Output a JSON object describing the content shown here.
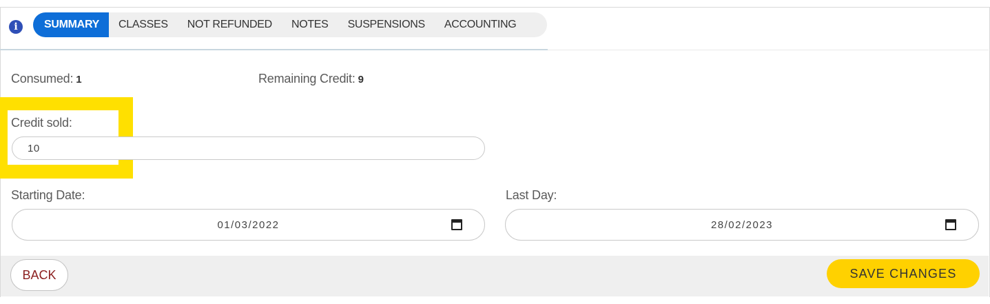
{
  "tabs": [
    {
      "label": "SUMMARY",
      "active": true
    },
    {
      "label": "CLASSES"
    },
    {
      "label": "NOT REFUNDED"
    },
    {
      "label": "NOTES"
    },
    {
      "label": "SUSPENSIONS"
    },
    {
      "label": "ACCOUNTING"
    }
  ],
  "info_icon": {
    "name": "info-icon",
    "glyph": "i"
  },
  "summary": {
    "consumed_label": "Consumed:",
    "consumed_value": "1",
    "remaining_label": "Remaining Credit:",
    "remaining_value": "9"
  },
  "credit_sold": {
    "label": "Credit sold:",
    "value": "10"
  },
  "starting_date": {
    "label": "Starting Date:",
    "value": "01/03/2022",
    "icon": "calendar-icon"
  },
  "last_day": {
    "label": "Last Day:",
    "value": "28/02/2023",
    "icon": "calendar-icon"
  },
  "footer": {
    "back_label": "BACK",
    "save_label": "SAVE CHANGES"
  },
  "colors": {
    "active_tab": "#0e6ed8",
    "save_button": "#ffd100",
    "highlight": "#ffe000",
    "back_text": "#8b1e1e"
  }
}
